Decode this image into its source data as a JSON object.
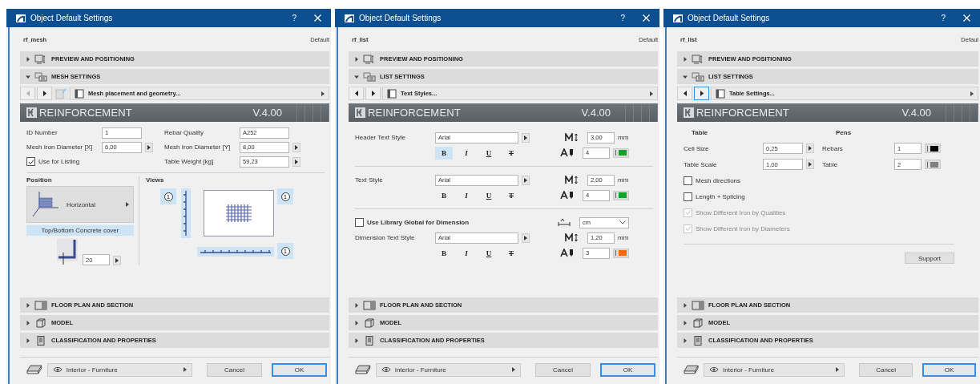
{
  "dialogs": [
    {
      "title": "Object Default Settings",
      "help": "?",
      "object_name": "rf_mesh",
      "default_label": "Default",
      "sections_top": [
        {
          "label": "PREVIEW AND POSITIONING",
          "kind": "preview",
          "expanded": false
        },
        {
          "label": "MESH SETTINGS",
          "kind": "settings",
          "expanded": true
        }
      ],
      "nav": {
        "page": "Mesh placement and geometry...",
        "prev_disabled": true,
        "next_focused": false,
        "extra_icon": true
      },
      "banner": {
        "title": "REINFORCEMENT",
        "version": "V.4.00"
      },
      "content": {
        "kind": "mesh",
        "left_fields": [
          {
            "label": "ID Number",
            "value": "1",
            "stepper": false
          },
          {
            "label": "Mesh Iron Diameter [X]",
            "value": "6,00",
            "stepper": true
          }
        ],
        "listing": {
          "label": "Use for Listing",
          "checked": true
        },
        "right_fields": [
          {
            "label": "Rebar Quality",
            "value": "A252",
            "stepper": false
          },
          {
            "label": "Mesh Iron Diameter [Y]",
            "value": "8,00",
            "stepper": true
          },
          {
            "label": "Table Weight [kg]",
            "value": "59,23",
            "stepper": true
          }
        ],
        "position": {
          "heading": "Position",
          "orientation": "Horizontal",
          "cover_label": "Top/Bottom Concrete cover",
          "cover_value": "20"
        },
        "views": {
          "heading": "Views",
          "markers": [
            "1",
            "1",
            "1"
          ]
        }
      },
      "sections_bottom": [
        {
          "label": "FLOOR PLAN AND SECTION",
          "kind": "floor_plan",
          "expanded": false
        },
        {
          "label": "MODEL",
          "kind": "model",
          "expanded": false
        },
        {
          "label": "CLASSIFICATION AND PROPERTIES",
          "kind": "classification",
          "expanded": false
        }
      ],
      "footer": {
        "layer": "Interior - Furniture",
        "cancel": "Cancel",
        "ok": "OK"
      }
    },
    {
      "title": "Object Default Settings",
      "help": "?",
      "object_name": "rf_list",
      "default_label": "Default",
      "sections_top": [
        {
          "label": "PREVIEW AND POSITIONING",
          "kind": "preview",
          "expanded": false
        },
        {
          "label": "LIST SETTINGS",
          "kind": "settings",
          "expanded": true
        }
      ],
      "nav": {
        "page": "Text Styles...",
        "prev_disabled": false,
        "next_focused": false,
        "extra_icon": false
      },
      "banner": {
        "title": "REINFORCEMENT",
        "version": "V.4.00"
      },
      "content": {
        "kind": "text_styles",
        "rows": [
          {
            "label": "Header Text Style",
            "font": "Arial",
            "size": "3,00",
            "unit": "mm",
            "pen": "4",
            "color": "#15a02c",
            "styles": [
              {
                "label": "B",
                "kind": "bold",
                "selected": true
              },
              {
                "label": "I",
                "kind": "italic",
                "selected": false
              },
              {
                "label": "U",
                "kind": "underline",
                "selected": false
              },
              {
                "label": "T",
                "kind": "strike",
                "selected": false
              }
            ]
          },
          {
            "label": "Text Style",
            "font": "Arial",
            "size": "2,00",
            "unit": "mm",
            "pen": "4",
            "color": "#15a02c",
            "styles": [
              {
                "label": "B",
                "kind": "bold",
                "selected": false
              },
              {
                "label": "I",
                "kind": "italic",
                "selected": false
              },
              {
                "label": "U",
                "kind": "underline",
                "selected": false
              },
              {
                "label": "T",
                "kind": "strike",
                "selected": false
              }
            ]
          }
        ],
        "dimension_toggle": {
          "label": "Use Library Global for Dimension",
          "checked": false,
          "unit": "cm"
        },
        "dimension_row": {
          "label": "Dimension Text Style",
          "font": "Arial",
          "size": "1,20",
          "unit": "mm",
          "pen": "3",
          "color": "#f26a10",
          "styles": [
            {
              "label": "B",
              "kind": "bold",
              "selected": false
            },
            {
              "label": "I",
              "kind": "italic",
              "selected": false
            },
            {
              "label": "U",
              "kind": "underline",
              "selected": false
            },
            {
              "label": "T",
              "kind": "strike",
              "selected": false
            }
          ]
        }
      },
      "sections_bottom": [
        {
          "label": "FLOOR PLAN AND SECTION",
          "kind": "floor_plan",
          "expanded": false
        },
        {
          "label": "MODEL",
          "kind": "model",
          "expanded": false
        },
        {
          "label": "CLASSIFICATION AND PROPERTIES",
          "kind": "classification",
          "expanded": false
        }
      ],
      "footer": {
        "layer": "Interior - Furniture",
        "cancel": "Cancel",
        "ok": "OK"
      }
    },
    {
      "title": "Object Default Settings",
      "help": "?",
      "object_name": "rf_list",
      "default_label": "Defaul",
      "sections_top": [
        {
          "label": "PREVIEW AND POSITIONING",
          "kind": "preview",
          "expanded": false
        },
        {
          "label": "LIST SETTINGS",
          "kind": "settings",
          "expanded": true
        }
      ],
      "nav": {
        "page": "Table Settings...",
        "prev_disabled": false,
        "next_focused": true,
        "extra_icon": false
      },
      "banner": {
        "title": "REINFORCEMENT",
        "version": "V.4.00"
      },
      "content": {
        "kind": "table",
        "table_heading": "Table",
        "pens_heading": "Pens",
        "rows": [
          {
            "label": "Cell Size",
            "value": "0,25",
            "pen_label": "Rebars",
            "pen": "1",
            "color": "#000000"
          },
          {
            "label": "Table Scale",
            "value": "1,00",
            "pen_label": "Table",
            "pen": "2",
            "color": "#7f7f7f"
          }
        ],
        "checkboxes": [
          {
            "label": "Mesh directions",
            "checked": false,
            "disabled": false
          },
          {
            "label": "Length + Splicing",
            "checked": false,
            "disabled": false
          },
          {
            "label": "Show Different Iron by Qualities",
            "checked": true,
            "disabled": true
          },
          {
            "label": "Show Different Iron by Diameters",
            "checked": true,
            "disabled": true
          }
        ],
        "support_button": "Support"
      },
      "sections_bottom": [
        {
          "label": "FLOOR PLAN AND SECTION",
          "kind": "floor_plan",
          "expanded": false
        },
        {
          "label": "MODEL",
          "kind": "model",
          "expanded": false
        },
        {
          "label": "CLASSIFICATION AND PROPERTIES",
          "kind": "classification",
          "expanded": false
        }
      ],
      "footer": {
        "layer": "Interior - Furniture",
        "cancel": "Cancel",
        "ok": "OK"
      }
    }
  ]
}
